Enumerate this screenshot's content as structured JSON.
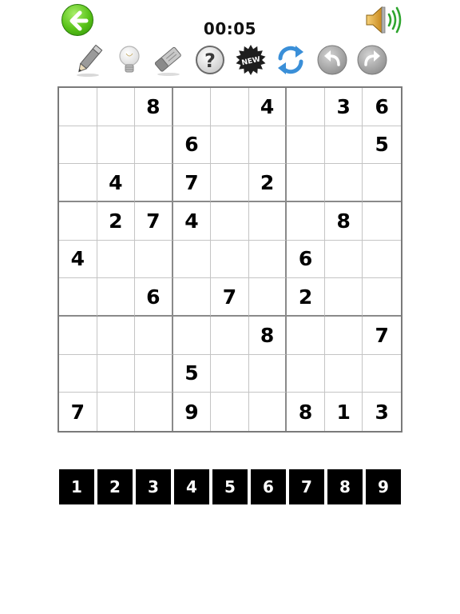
{
  "header": {
    "timer": "00:05"
  },
  "toolbar": {
    "items": [
      {
        "icon": "pencil-icon"
      },
      {
        "icon": "lightbulb-icon"
      },
      {
        "icon": "eraser-icon"
      },
      {
        "icon": "help-icon"
      },
      {
        "icon": "new-game-icon",
        "label": "NEW"
      },
      {
        "icon": "refresh-icon"
      },
      {
        "icon": "undo-icon"
      },
      {
        "icon": "redo-icon"
      }
    ]
  },
  "board": {
    "rows": [
      [
        "",
        "",
        "8",
        "",
        "",
        "4",
        "",
        "3",
        "6"
      ],
      [
        "",
        "",
        "",
        "6",
        "",
        "",
        "",
        "",
        "5"
      ],
      [
        "",
        "4",
        "",
        "7",
        "",
        "2",
        "",
        "",
        ""
      ],
      [
        "",
        "2",
        "7",
        "4",
        "",
        "",
        "",
        "8",
        ""
      ],
      [
        "4",
        "",
        "",
        "",
        "",
        "",
        "6",
        "",
        ""
      ],
      [
        "",
        "",
        "6",
        "",
        "7",
        "",
        "2",
        "",
        ""
      ],
      [
        "",
        "",
        "",
        "",
        "",
        "8",
        "",
        "",
        "7"
      ],
      [
        "",
        "",
        "",
        "5",
        "",
        "",
        "",
        "",
        ""
      ],
      [
        "7",
        "",
        "",
        "9",
        "",
        "",
        "8",
        "1",
        "3"
      ]
    ]
  },
  "numpad": {
    "keys": [
      "1",
      "2",
      "3",
      "4",
      "5",
      "6",
      "7",
      "8",
      "9"
    ]
  },
  "colors": {
    "back_button": "#58c218",
    "refresh_icon": "#3a8fd8",
    "grid_border": "#7a7a7a"
  }
}
